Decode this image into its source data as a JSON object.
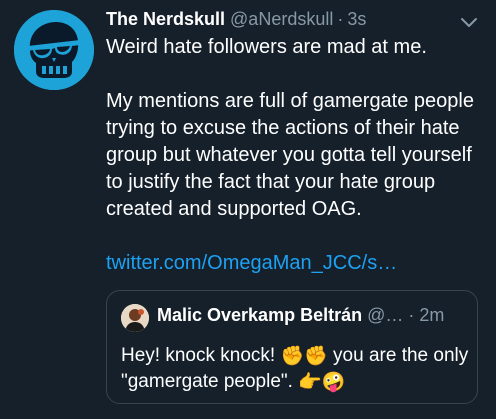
{
  "tweet": {
    "display_name": "The Nerdskull",
    "handle": "@aNerdskull",
    "separator": "·",
    "time": "3s",
    "text_line1": "Weird hate followers are mad at me.",
    "text_paragraph2": "My mentions are full of gamergate people trying to excuse the actions of their hate group but whatever you gotta tell yourself to justify the fact that your hate group created and supported OAG.",
    "link": "twitter.com/OmegaMan_JCC/s…",
    "menu_icon": "chevron-down-icon"
  },
  "quoted_tweet": {
    "display_name": "Malic Overkamp Beltrán",
    "handle": "@…",
    "separator": "·",
    "time": "2m",
    "text_part1": "Hey! knock knock! ",
    "emoji_fists": "✊✊",
    "text_part2": " you are the only \"gamergate people\". ",
    "emoji_point": "👉",
    "emoji_face": "🤪"
  },
  "colors": {
    "background": "#15202b",
    "secondary_text": "#8899a6",
    "link": "#1da1f2",
    "avatar": "#1ea3d8",
    "border": "#38444d"
  }
}
